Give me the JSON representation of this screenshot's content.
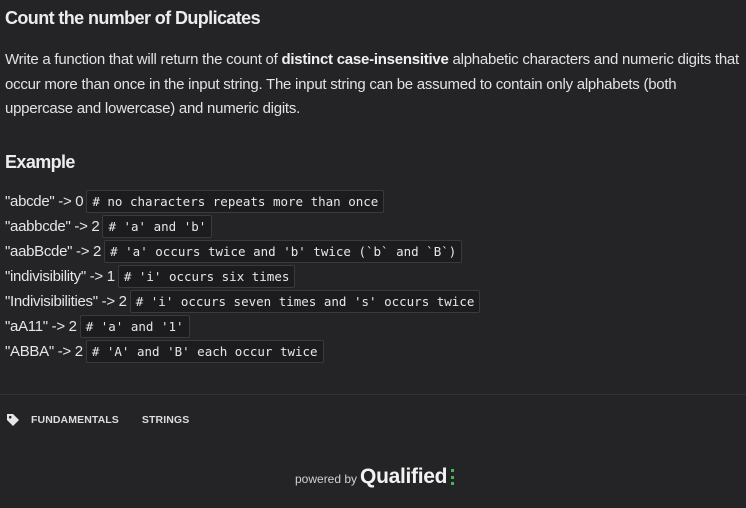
{
  "kata": {
    "title": "Count the number of Duplicates",
    "description": {
      "before": "Write a function that will return the count of ",
      "bold": "distinct case-insensitive",
      "after": " alphabetic characters and numeric digits that occur more than once in the input string. The input string can be assumed to contain only alphabets (both uppercase and lowercase) and numeric digits."
    },
    "example_heading": "Example",
    "examples": [
      {
        "text": "\"abcde\" -> 0",
        "comment": "# no characters repeats more than once"
      },
      {
        "text": "\"aabbcde\" -> 2",
        "comment": "# 'a' and 'b'"
      },
      {
        "text": "\"aabBcde\" -> 2",
        "comment": "# 'a' occurs twice and 'b' twice (`b` and `B`)"
      },
      {
        "text": "\"indivisibility\" -> 1",
        "comment": "# 'i' occurs six times"
      },
      {
        "text": "\"Indivisibilities\" -> 2",
        "comment": "# 'i' occurs seven times and 's' occurs twice"
      },
      {
        "text": "\"aA11\" -> 2",
        "comment": "# 'a' and '1'"
      },
      {
        "text": "\"ABBA\" -> 2",
        "comment": "# 'A' and 'B' each occur twice"
      }
    ]
  },
  "tags": {
    "icon": "tag-icon",
    "items": [
      "FUNDAMENTALS",
      "STRINGS"
    ]
  },
  "footer": {
    "powered_by": "powered by",
    "brand": "Qualified",
    "brand_accent": "#3fb950"
  },
  "colors": {
    "background": "#242426",
    "code_background": "#1c1c1e"
  }
}
